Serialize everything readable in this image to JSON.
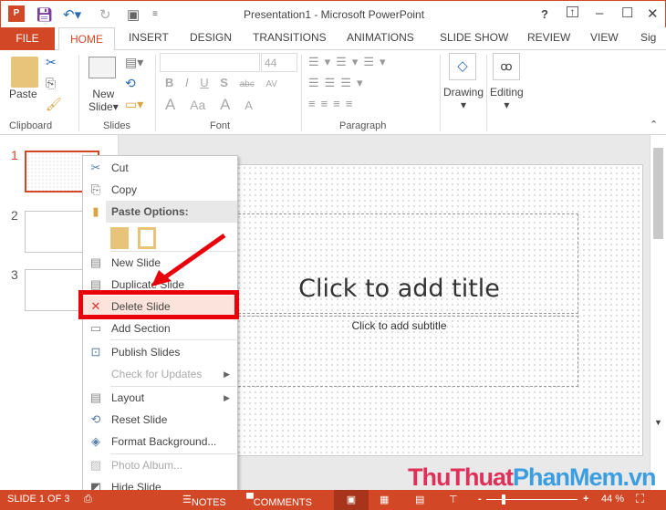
{
  "window": {
    "title": "Presentation1 - Microsoft PowerPoint",
    "help": "?",
    "minimize": "–",
    "maximize": "☐",
    "close": "✕"
  },
  "tabs": [
    "FILE",
    "HOME",
    "INSERT",
    "DESIGN",
    "TRANSITIONS",
    "ANIMATIONS",
    "SLIDE SHOW",
    "REVIEW",
    "VIEW",
    "Sig"
  ],
  "ribbon": {
    "paste": "Paste",
    "new_slide_1": "New",
    "new_slide_2": "Slide",
    "font_size": "44",
    "drawing": "Drawing",
    "editing": "Editing",
    "groups": {
      "clipboard": "Clipboard",
      "slides": "Slides",
      "font": "Font",
      "paragraph": "Paragraph"
    },
    "font_buttons": [
      "B",
      "I",
      "U",
      "S",
      "abc",
      "AV",
      "A",
      "Aa",
      "A",
      "A"
    ]
  },
  "slides": {
    "numbers": [
      "1",
      "2",
      "3"
    ]
  },
  "slide": {
    "title": "Click to add title",
    "subtitle": "Click to add subtitle"
  },
  "context_menu": {
    "items": [
      {
        "label": "Cut",
        "icon": "scissors-icon"
      },
      {
        "label": "Copy",
        "icon": "copy-icon"
      },
      {
        "label": "Paste Options:",
        "icon": "paste-icon"
      },
      {
        "label": "New Slide",
        "icon": "new-slide-icon"
      },
      {
        "label": "Duplicate Slide",
        "icon": "duplicate-slide-icon"
      },
      {
        "label": "Delete Slide",
        "icon": "delete-slide-icon"
      },
      {
        "label": "Add Section",
        "icon": "add-section-icon"
      },
      {
        "label": "Publish Slides",
        "icon": "publish-icon"
      },
      {
        "label": "Check for Updates",
        "icon": ""
      },
      {
        "label": "Layout",
        "icon": "layout-icon"
      },
      {
        "label": "Reset Slide",
        "icon": "reset-icon"
      },
      {
        "label": "Format Background...",
        "icon": "format-bg-icon"
      },
      {
        "label": "Photo Album...",
        "icon": "photo-album-icon"
      },
      {
        "label": "Hide Slide",
        "icon": "hide-slide-icon"
      }
    ]
  },
  "status": {
    "slide_info": "SLIDE 1 OF 3",
    "notes": "NOTES",
    "comments": "COMMENTS",
    "zoom": "44 %",
    "zoom_minus": "-",
    "zoom_plus": "+"
  },
  "zoom_level_percent": 44,
  "watermark": {
    "part1": "ThuThuat",
    "part2": "PhanMem",
    "part3": ".vn"
  },
  "colors": {
    "accent": "#D24726",
    "highlight": "#E8000B"
  }
}
